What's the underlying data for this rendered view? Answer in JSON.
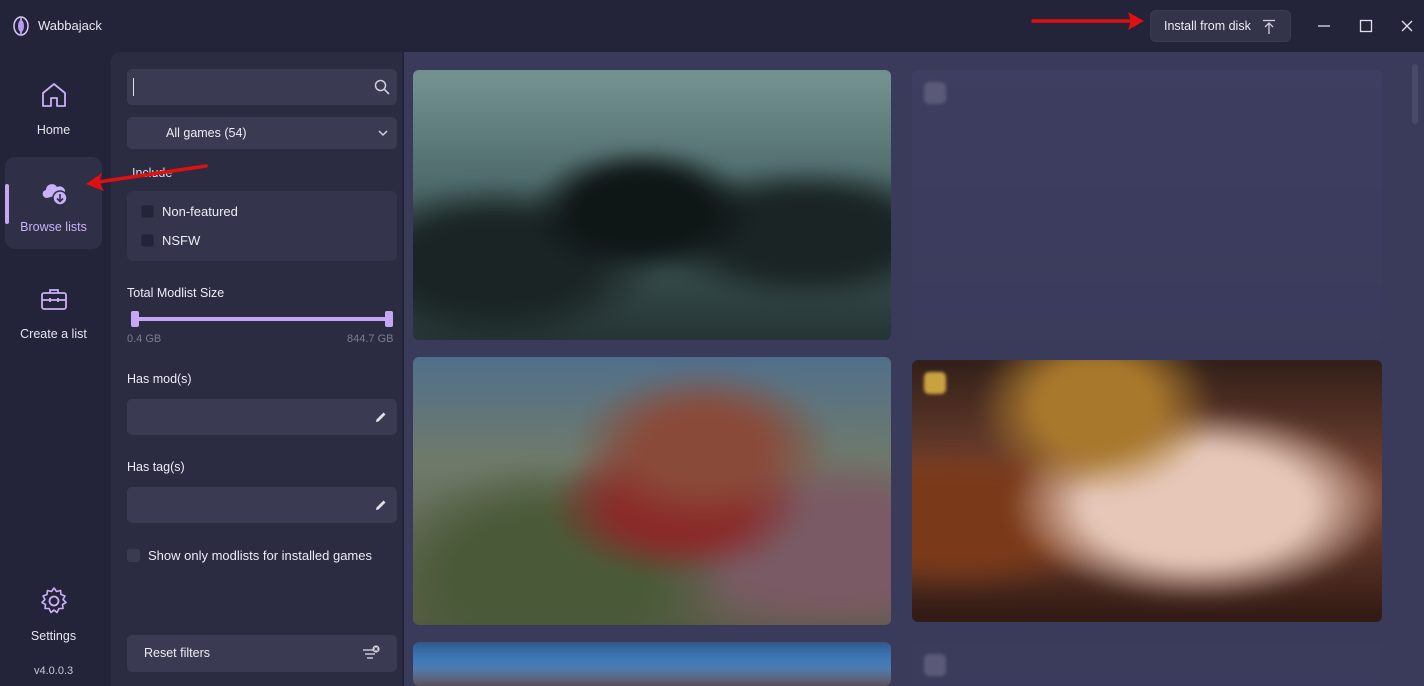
{
  "app": {
    "title": "Wabbajack",
    "version": "v4.0.0.3"
  },
  "titlebar": {
    "install_label": "Install from disk"
  },
  "nav": {
    "items": [
      {
        "label": "Home",
        "icon": "home-icon"
      },
      {
        "label": "Browse lists",
        "icon": "cloud-download-icon",
        "active": true
      },
      {
        "label": "Create a list",
        "icon": "toolbox-icon"
      }
    ],
    "settings_label": "Settings"
  },
  "filters": {
    "search_value": "",
    "game_select": "All games (54)",
    "include_label": "Include",
    "include_options": [
      "Non-featured",
      "NSFW"
    ],
    "size_label": "Total Modlist Size",
    "size_min": "0.4 GB",
    "size_max": "844.7 GB",
    "has_mods_label": "Has mod(s)",
    "has_tags_label": "Has tag(s)",
    "installed_only_label": "Show only modlists for installed games",
    "reset_label": "Reset filters"
  },
  "colors": {
    "accent": "#c6a7f5",
    "background": "#23233a",
    "panel": "#2b2b41",
    "annotation_arrow": "#e01010"
  }
}
